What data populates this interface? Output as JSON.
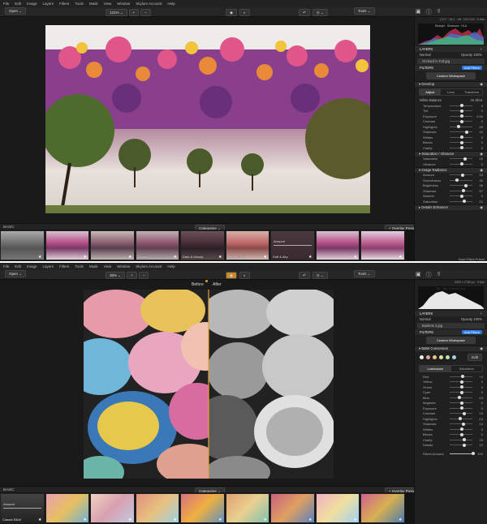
{
  "screen1": {
    "menu": [
      "File",
      "Edit",
      "Image",
      "Layers",
      "Filters",
      "Tools",
      "Mask",
      "View",
      "Window",
      "Skylum Account",
      "Help"
    ],
    "toolbar": {
      "open": "Open",
      "zoom": "131%",
      "tools": "Tools"
    },
    "histogram_info": "ƒ/2.2 · 18.1 ·  1/8 · ISO 100 · 6 Mar",
    "histogram_sub": "Straight · Shadows  · HLA",
    "layers": {
      "title": "LAYERS",
      "blend": "Normal",
      "opacity": "Opacity 100%",
      "layer_name": "Orchard in Fall.jpg"
    },
    "filters": {
      "title": "FILTERS",
      "add": "Add Filters",
      "workspace": "Custom Workspace"
    },
    "develop": {
      "title": "Develop",
      "tabs": [
        "Adjust",
        "Lens",
        "Transform"
      ],
      "wb_label": "White Balance",
      "wb_value": "As Shot",
      "sliders": [
        {
          "label": "Temperature",
          "value": "0",
          "pos": 0.5
        },
        {
          "label": "Tint",
          "value": "0",
          "pos": 0.5
        },
        {
          "label": "Exposure",
          "value": "0.00",
          "pos": 0.5
        },
        {
          "label": "Contrast",
          "value": "0",
          "pos": 0.5
        },
        {
          "label": "Highlights",
          "value": "-30",
          "pos": 0.35
        },
        {
          "label": "Shadows",
          "value": "44",
          "pos": 0.72
        },
        {
          "label": "Whites",
          "value": "0",
          "pos": 0.5
        },
        {
          "label": "Blacks",
          "value": "0",
          "pos": 0.5
        },
        {
          "label": "Clarity",
          "value": "0",
          "pos": 0.5
        }
      ]
    },
    "saturation": {
      "title": "Saturation / Vibrance",
      "sliders": [
        {
          "label": "Saturation",
          "value": "26",
          "pos": 0.63
        },
        {
          "label": "Vibrance",
          "value": "0",
          "pos": 0.5
        }
      ]
    },
    "radiance": {
      "title": "Image Radiance",
      "sliders": [
        {
          "label": "Amount",
          "value": "53",
          "pos": 0.53
        },
        {
          "label": "Smoothness",
          "value": "30",
          "pos": 0.3
        },
        {
          "label": "Brightness",
          "value": "36",
          "pos": 0.68
        },
        {
          "label": "Shadows",
          "value": "57",
          "pos": 0.57
        },
        {
          "label": "Warmth",
          "value": "0",
          "pos": 0.5
        },
        {
          "label": "Saturation",
          "value": "21",
          "pos": 0.6
        }
      ]
    },
    "details": {
      "title": "Details Enhancer"
    },
    "bottom": {
      "basic": "BASIC",
      "categories": "Categories",
      "overlay": "Overlay Preset",
      "save": "Save Filters Preset"
    },
    "film": [
      {
        "label": "",
        "style": "bw"
      },
      {
        "label": "",
        "style": "pink"
      },
      {
        "label": "",
        "style": "muted"
      },
      {
        "label": "Classic",
        "style": "muted2"
      },
      {
        "label": "Dark & Moody",
        "style": "dark"
      },
      {
        "label": "Warm & Pink",
        "style": "warm"
      },
      {
        "label": "Soft & Airy",
        "style": "amount"
      },
      {
        "label": "",
        "style": "pink"
      },
      {
        "label": "",
        "style": "pink2"
      }
    ],
    "film_amount": "Amount"
  },
  "screen2": {
    "menu": [
      "File",
      "Edit",
      "Image",
      "Layers",
      "Filters",
      "Tools",
      "Mask",
      "View",
      "Window",
      "Skylum Account",
      "Help"
    ],
    "toolbar": {
      "open": "Open",
      "zoom": "38%",
      "tools": "Tools"
    },
    "before": "Before",
    "after": "After",
    "histogram_info": "2000 × 1780 px · 4 Mar",
    "histogram_sub": "R8 · HB  |  Exfmnl  |  HLA",
    "layers": {
      "title": "LAYERS",
      "blend": "Normal",
      "opacity": "Opacity 100%",
      "layer_name": "Baskets 2.jpg"
    },
    "filters": {
      "title": "FILTERS",
      "add": "Add Filters",
      "workspace": "Custom Workspace"
    },
    "bw": {
      "title": "B&W Conversion",
      "edit": "Edit",
      "tabs": [
        "Luminance",
        "Saturation"
      ],
      "swatches": [
        "#eeeeee",
        "#e8a28c",
        "#e6c48a",
        "#e6e29c",
        "#b6e6a8",
        "#9ed4ee"
      ],
      "sliders": [
        {
          "label": "Red",
          "value": "+4",
          "pos": 0.54
        },
        {
          "label": "Yellow",
          "value": "0",
          "pos": 0.5
        },
        {
          "label": "Green",
          "value": "0",
          "pos": 0.5
        },
        {
          "label": "Cyan",
          "value": "0",
          "pos": 0.5
        },
        {
          "label": "Blue",
          "value": "-10",
          "pos": 0.4
        },
        {
          "label": "Magenta",
          "value": "0",
          "pos": 0.5
        },
        {
          "label": "Exposure",
          "value": "0",
          "pos": 0.5
        },
        {
          "label": "Contrast",
          "value": "18",
          "pos": 0.6
        },
        {
          "label": "Highlights",
          "value": "-10",
          "pos": 0.42
        },
        {
          "label": "Shadows",
          "value": "10",
          "pos": 0.58
        },
        {
          "label": "Whites",
          "value": "0",
          "pos": 0.5
        },
        {
          "label": "Blacks",
          "value": "0",
          "pos": 0.5
        },
        {
          "label": "Clarity",
          "value": "23",
          "pos": 0.62
        },
        {
          "label": "Details",
          "value": "22",
          "pos": 0.61
        }
      ],
      "amount_label": "Filters Amount",
      "amount_value": "100"
    },
    "bottom": {
      "basic": "BASIC",
      "categories": "Categories",
      "overlay": "Overlay Preset"
    },
    "film": [
      {
        "label": "Classic B&W",
        "style": "bwb"
      },
      {
        "label": "",
        "style": "b1"
      },
      {
        "label": "",
        "style": "b2"
      },
      {
        "label": "",
        "style": "b3"
      },
      {
        "label": "",
        "style": "b4"
      },
      {
        "label": "",
        "style": "b5"
      },
      {
        "label": "",
        "style": "b6"
      },
      {
        "label": "",
        "style": "b7"
      },
      {
        "label": "",
        "style": "b8"
      }
    ],
    "film_amount": "Amount"
  }
}
